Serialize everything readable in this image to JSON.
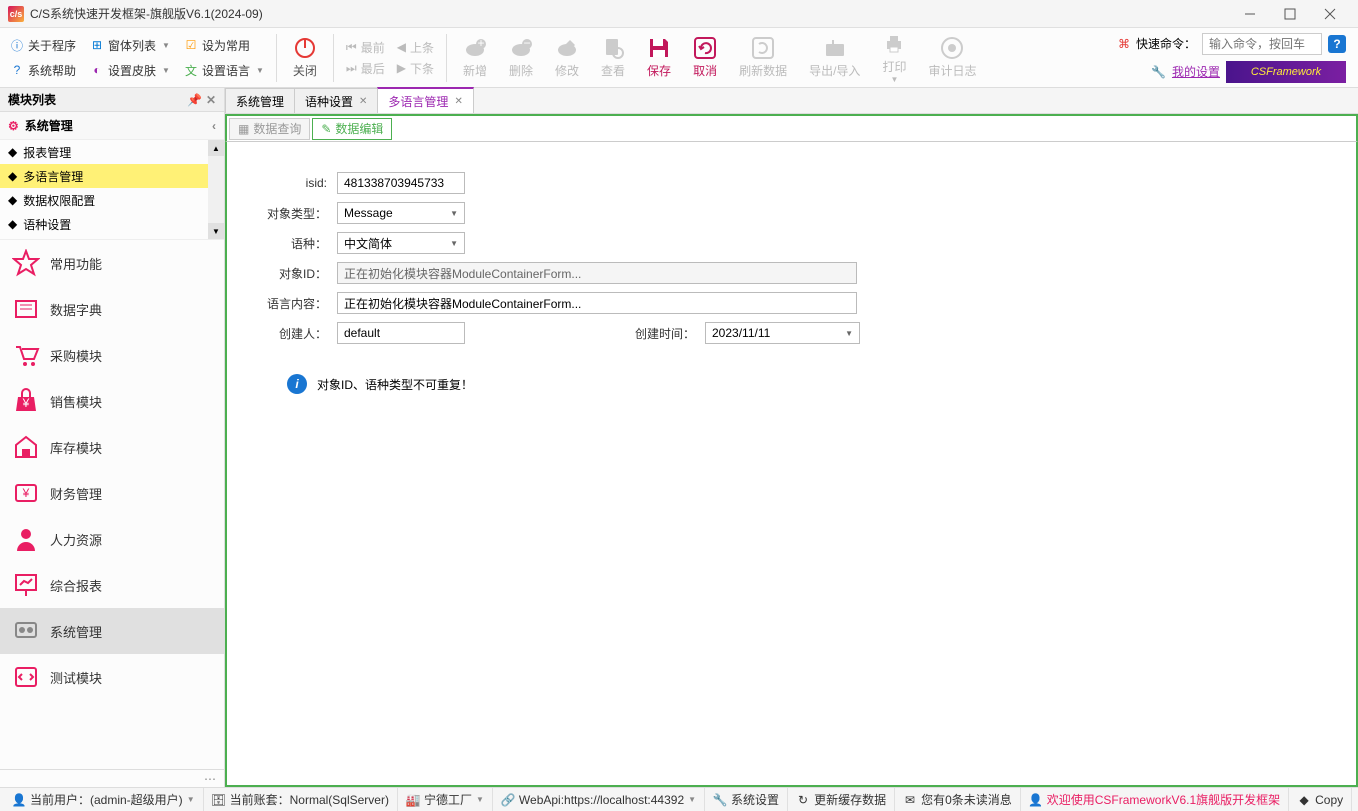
{
  "window": {
    "title": "C/S系统快速开发框架-旗舰版V6.1(2024-09)",
    "app_icon_text": "c/s"
  },
  "menubar": {
    "about": "关于程序",
    "window_list": "窗体列表",
    "set_common": "设为常用",
    "system_help": "系统帮助",
    "set_skin": "设置皮肤",
    "set_language": "设置语言"
  },
  "nav": {
    "first": "最前",
    "prev": "上条",
    "last": "最后",
    "next": "下条"
  },
  "toolbar": {
    "close": "关闭",
    "add": "新增",
    "delete": "删除",
    "modify": "修改",
    "view": "查看",
    "save": "保存",
    "cancel": "取消",
    "refresh": "刷新数据",
    "import_export": "导出/导入",
    "print": "打印",
    "audit": "审计日志"
  },
  "quick": {
    "label": "快速命令：",
    "placeholder": "输入命令，按回车",
    "my_settings": "我的设置",
    "framework": "CSFramework"
  },
  "sidebar": {
    "header": "模块列表",
    "section": "系统管理",
    "tree": [
      {
        "label": "报表管理",
        "active": false
      },
      {
        "label": "多语言管理",
        "active": true
      },
      {
        "label": "数据权限配置",
        "active": false
      },
      {
        "label": "语种设置",
        "active": false
      }
    ],
    "modules": [
      {
        "label": "常用功能",
        "color": "#e91e63"
      },
      {
        "label": "数据字典",
        "color": "#e91e63"
      },
      {
        "label": "采购模块",
        "color": "#e91e63"
      },
      {
        "label": "销售模块",
        "color": "#e91e63"
      },
      {
        "label": "库存模块",
        "color": "#e91e63"
      },
      {
        "label": "财务管理",
        "color": "#e91e63"
      },
      {
        "label": "人力资源",
        "color": "#e91e63"
      },
      {
        "label": "综合报表",
        "color": "#e91e63"
      },
      {
        "label": "系统管理",
        "color": "#888",
        "active": true
      },
      {
        "label": "测试模块",
        "color": "#e91e63"
      }
    ]
  },
  "tabs": {
    "items": [
      {
        "label": "系统管理",
        "closable": false
      },
      {
        "label": "语种设置",
        "closable": true
      },
      {
        "label": "多语言管理",
        "closable": true,
        "active": true
      }
    ]
  },
  "subtabs": {
    "query": "数据查询",
    "edit": "数据编辑"
  },
  "form": {
    "isid_label": "isid:",
    "isid_value": "481338703945733",
    "obj_type_label": "对象类型：",
    "obj_type_value": "Message",
    "lang_label": "语种：",
    "lang_value": "中文简体",
    "obj_id_label": "对象ID：",
    "obj_id_value": "正在初始化模块容器ModuleContainerForm...",
    "lang_content_label": "语言内容：",
    "lang_content_value": "正在初始化模块容器ModuleContainerForm...",
    "creator_label": "创建人：",
    "creator_value": "default",
    "create_time_label": "创建时间：",
    "create_time_value": "2023/11/11",
    "info_text": "对象ID、语种类型不可重复！"
  },
  "statusbar": {
    "user": "当前用户：(admin-超级用户)",
    "account": "当前账套：Normal(SqlServer)",
    "factory": "宁德工厂",
    "webapi": "WebApi:https://localhost:44392",
    "sys_settings": "系统设置",
    "update_cache": "更新缓存数据",
    "unread": "您有0条未读消息",
    "welcome": "欢迎使用CSFrameworkV6.1旗舰版开发框架",
    "copy": "Copy"
  }
}
